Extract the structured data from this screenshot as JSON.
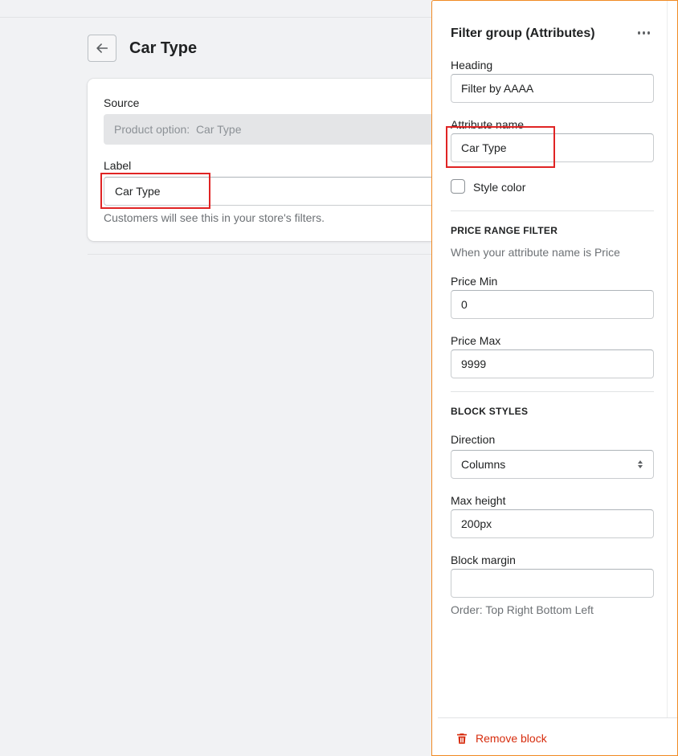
{
  "page": {
    "title": "Car Type",
    "source_label": "Source",
    "source_value": "Product option:  Car Type",
    "label_label": "Label",
    "label_value": "Car Type",
    "label_help": "Customers will see this in your store's filters."
  },
  "panel": {
    "title": "Filter group (Attributes)",
    "heading_label": "Heading",
    "heading_value": "Filter by AAAA",
    "attribute_label": "Attribute name",
    "attribute_value": "Car Type",
    "style_color_label": "Style color",
    "style_color_checked": false,
    "price_section": "PRICE RANGE FILTER",
    "price_help": "When your attribute name is Price",
    "price_min_label": "Price Min",
    "price_min_value": "0",
    "price_max_label": "Price Max",
    "price_max_value": "9999",
    "block_section": "BLOCK STYLES",
    "direction_label": "Direction",
    "direction_value": "Columns",
    "max_height_label": "Max height",
    "max_height_value": "200px",
    "block_margin_label": "Block margin",
    "block_margin_value": "",
    "block_margin_help": "Order: Top Right Bottom Left",
    "remove_label": "Remove block"
  },
  "icons": {
    "back": "arrow-left-icon",
    "more": "more-horizontal-icon",
    "select": "select-arrows-icon",
    "remove": "trash-icon"
  },
  "colors": {
    "background": "#f1f2f4",
    "highlight": "#e02424",
    "panel_border": "#f08a24",
    "destructive": "#d72c0d"
  }
}
